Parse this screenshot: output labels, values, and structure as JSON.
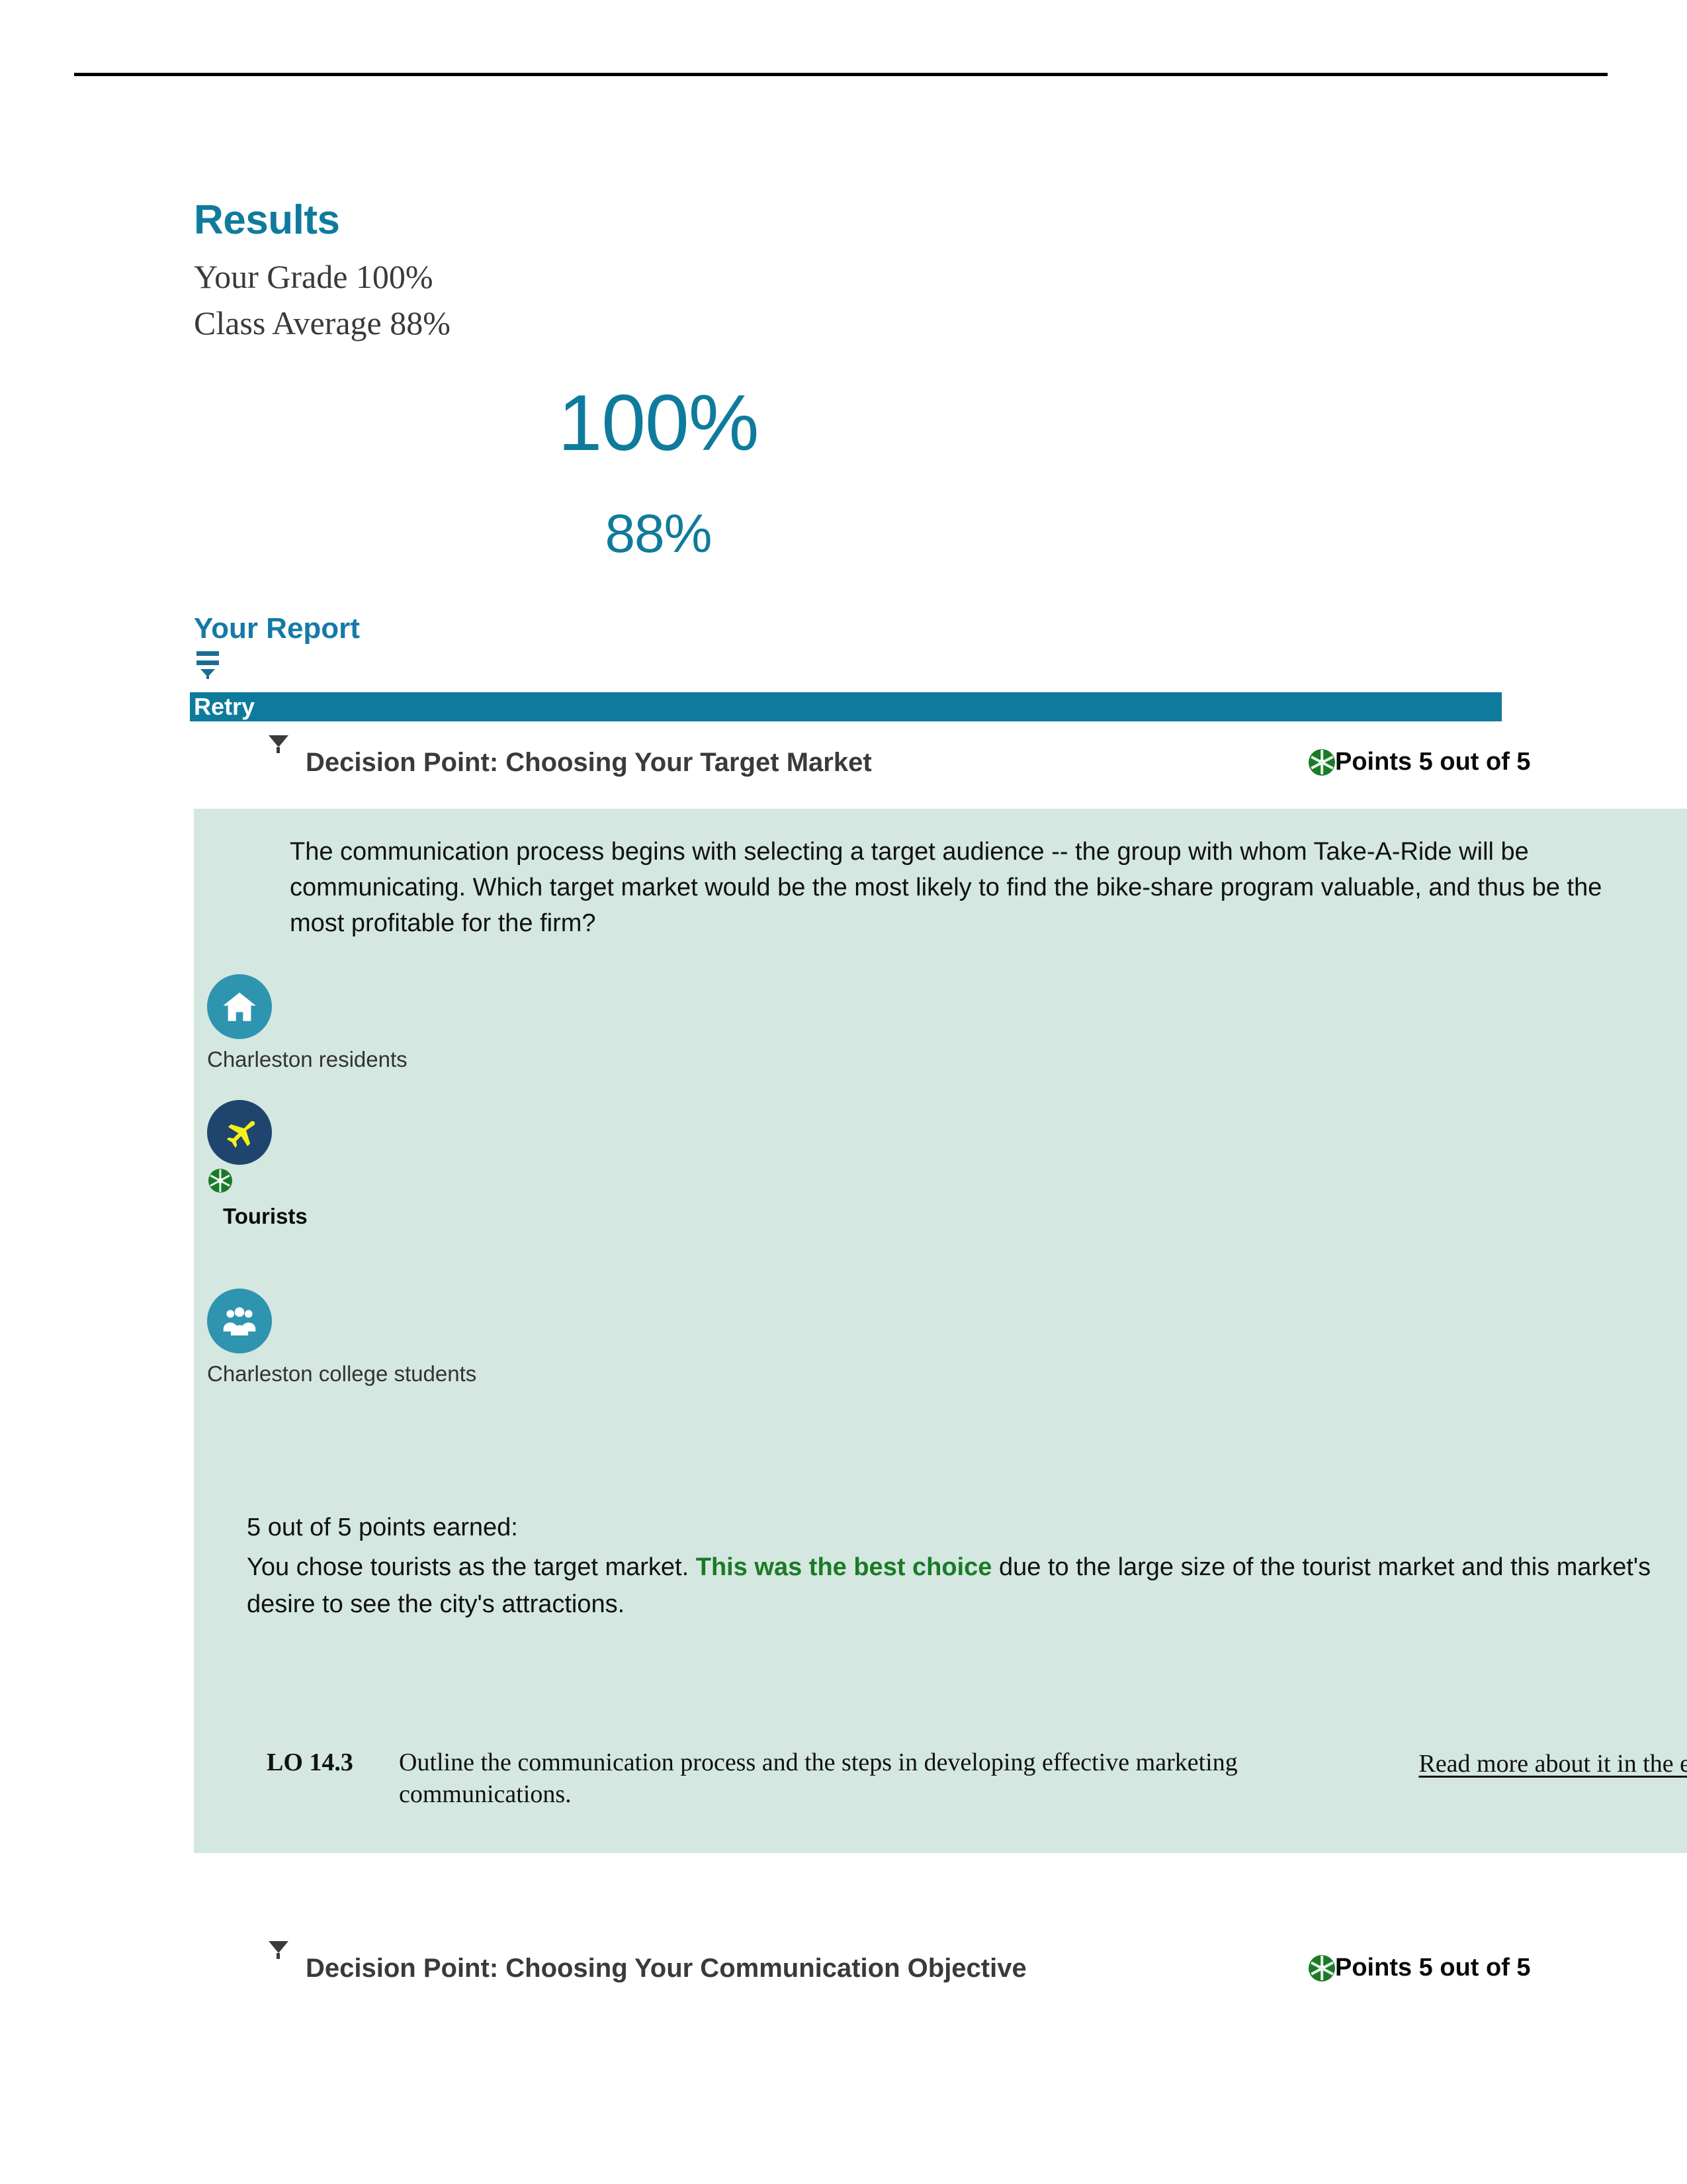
{
  "page": {
    "top_rule": "horizontal-rule"
  },
  "results": {
    "title": "Results",
    "your_grade_line": "Your Grade 100%",
    "class_average_line": "Class Average 88%",
    "your_grade_big": "100%",
    "class_average_big": "88%"
  },
  "report": {
    "title": "Your Report",
    "filter_icon": "filter-icon",
    "retry_label": "Retry"
  },
  "decision_points": [
    {
      "caret_icon": "caret-down-icon",
      "title": "Decision Point: Choosing Your Target Market",
      "points_badge_icon": "green-pinwheel-icon",
      "points_label": "Points 5 out of 5",
      "question": "The communication process begins with selecting a target audience -- the group with whom Take-A-Ride will be communicating. Which target market would be the most likely to find the bike-share program valuable, and thus be the most profitable for the firm?",
      "options": [
        {
          "icon": "home-icon",
          "label": "Charleston residents",
          "circle_color": "#2e94b0",
          "glyph_color": "#ffffff",
          "selected": false
        },
        {
          "icon": "airplane-icon",
          "label": "Tourists",
          "circle_color": "#1f456e",
          "glyph_color": "#f5f016",
          "selected": true,
          "badge_icon": "green-pinwheel-icon"
        },
        {
          "icon": "people-group-icon",
          "label": "Charleston college students",
          "circle_color": "#2e94b0",
          "glyph_color": "#ffffff",
          "selected": false
        }
      ],
      "feedback_earned": "5 out of 5 points earned:",
      "feedback_before": "You chose tourists as the target market. ",
      "feedback_highlight": "This was the best choice",
      "feedback_after": " due to the large size of the tourist market and this market's desire to see the city's attractions.",
      "lo_code": "LO 14.3",
      "lo_description": "Outline the communication process and the steps in developing effective marketing communications.",
      "etext_link": "Read more about it in the eText"
    },
    {
      "caret_icon": "caret-down-icon",
      "title": "Decision Point: Choosing Your Communication Objective",
      "points_badge_icon": "green-pinwheel-icon",
      "points_label": "Points 5 out of 5"
    }
  ],
  "colors": {
    "brand_teal": "#0f7b9c",
    "panel_green": "#d4e7e1",
    "success_green": "#1b7a27",
    "retry_bar": "#0f7b9c"
  }
}
